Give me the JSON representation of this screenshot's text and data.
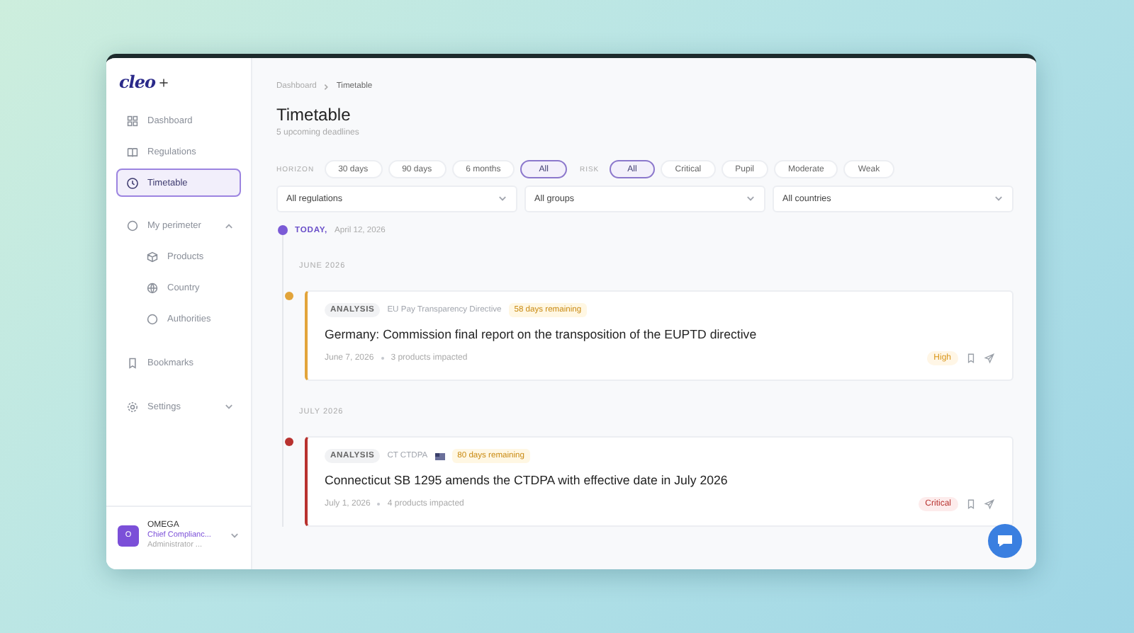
{
  "sidebar": {
    "logo": "cleo",
    "items": [
      {
        "label": "Dashboard",
        "selected": false
      },
      {
        "label": "Regulations",
        "selected": false
      },
      {
        "label": "Timetable",
        "selected": true
      },
      {
        "label": "My perimeter",
        "selected": false,
        "expanded": true,
        "children": [
          {
            "label": "Products",
            "selected": false
          },
          {
            "label": "Country",
            "selected": false
          },
          {
            "label": "Authorities",
            "selected": false
          }
        ]
      },
      {
        "label": "Bookmarks",
        "selected": false
      },
      {
        "label": "Settings",
        "selected": false,
        "expanded": false
      }
    ],
    "user": {
      "initial": "O",
      "name": "OMEGA",
      "role": "Chief Complianc...",
      "subtitle": "Administrator ..."
    }
  },
  "breadcrumb": [
    "Dashboard",
    "Timetable"
  ],
  "title": "Timetable",
  "subtitle": "5 upcoming deadlines",
  "filters": [
    {
      "label": "HORIZON",
      "options": [
        {
          "label": "30 days",
          "selected": false
        },
        {
          "label": "90 days",
          "selected": false
        },
        {
          "label": "6 months",
          "selected": false
        },
        {
          "label": "All",
          "selected": true
        }
      ]
    },
    {
      "label": "RISK",
      "options": [
        {
          "label": "All",
          "selected": true
        },
        {
          "label": "Critical",
          "selected": false
        },
        {
          "label": "Pupil",
          "selected": false
        },
        {
          "label": "Moderate",
          "selected": false
        },
        {
          "label": "Weak",
          "selected": false
        }
      ]
    }
  ],
  "dropdowns": [
    "All regulations",
    "All groups",
    "All countries"
  ],
  "today": {
    "label": "TODAY,",
    "date": "April 12, 2026"
  },
  "groups": [
    {
      "month": "JUNE 2026",
      "items": [
        {
          "color": "#e2a43a",
          "tag": "ANALYSIS",
          "regulation": "EU Pay Transparency Directive",
          "flag": false,
          "remaining": "58 days remaining",
          "title": "Germany: Commission final report on the transposition of the EUPTD directive",
          "date": "June 7, 2026",
          "impact": "3 products impacted",
          "risk": {
            "kind": "high",
            "label": "High"
          }
        }
      ]
    },
    {
      "month": "JULY 2026",
      "items": [
        {
          "color": "#b8322f",
          "tag": "ANALYSIS",
          "regulation": "CT CTDPA",
          "flag": true,
          "remaining": "80 days remaining",
          "title": "Connecticut SB 1295 amends the CTDPA with effective date in July 2026",
          "date": "July 1, 2026",
          "impact": "4 products impacted",
          "risk": {
            "kind": "critical",
            "label": "Critical"
          }
        }
      ]
    }
  ]
}
